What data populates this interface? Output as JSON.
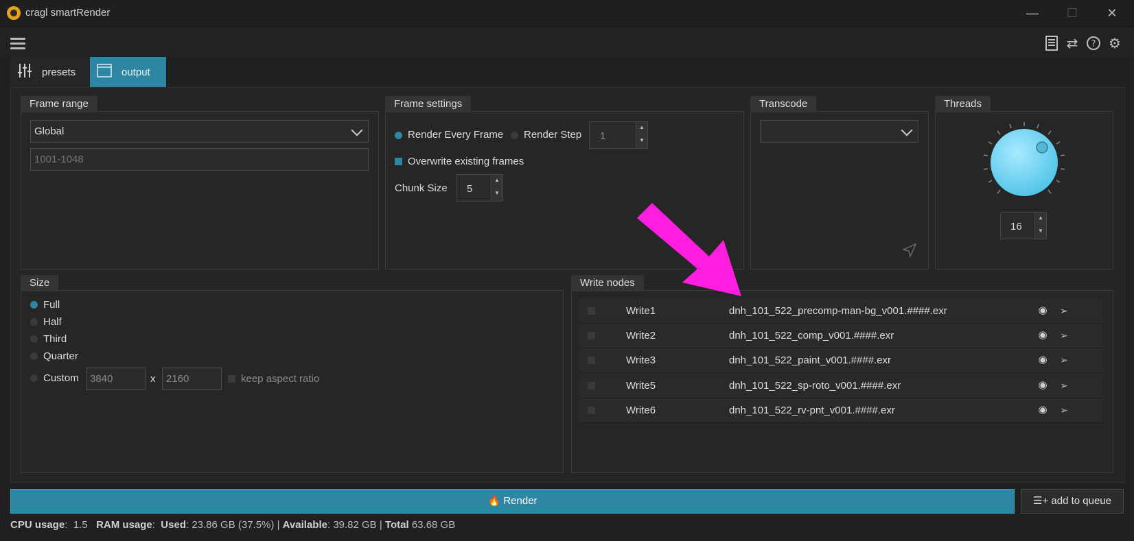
{
  "window": {
    "title": "cragl smartRender",
    "minimize_glyph": "—",
    "maximize_glyph": "☐",
    "close_glyph": "✕"
  },
  "toolbar": {
    "icons": [
      "hamburger-menu-icon",
      "document-icon",
      "swap-icon",
      "help-icon",
      "gear-icon"
    ]
  },
  "tabs": [
    {
      "label": "presets",
      "icon": "sliders-icon",
      "active": false
    },
    {
      "label": "output",
      "icon": "window-icon",
      "active": true
    }
  ],
  "frame_range": {
    "title": "Frame range",
    "mode_value": "Global",
    "range_placeholder": "1001-1048"
  },
  "frame_settings": {
    "title": "Frame settings",
    "render_every_frame": "Render Every Frame",
    "render_step": "Render Step",
    "step_value": "1",
    "overwrite_label": "Overwrite existing frames",
    "chunk_label": "Chunk Size",
    "chunk_value": "5"
  },
  "transcode": {
    "title": "Transcode",
    "value": ""
  },
  "threads": {
    "title": "Threads",
    "value": "16",
    "knob_fraction": 0.55
  },
  "size": {
    "title": "Size",
    "options": [
      "Full",
      "Half",
      "Third",
      "Quarter",
      "Custom"
    ],
    "selected": "Full",
    "width_value": "3840",
    "x_label": "x",
    "height_value": "2160",
    "keep_aspect_label": "keep aspect ratio"
  },
  "write_nodes": {
    "title": "Write nodes",
    "rows": [
      {
        "name": "Write1",
        "file": "dnh_101_522_precomp-man-bg_v001.####.exr"
      },
      {
        "name": "Write2",
        "file": "dnh_101_522_comp_v001.####.exr"
      },
      {
        "name": "Write3",
        "file": "dnh_101_522_paint_v001.####.exr"
      },
      {
        "name": "Write5",
        "file": "dnh_101_522_sp-roto_v001.####.exr"
      },
      {
        "name": "Write6",
        "file": "dnh_101_522_rv-pnt_v001.####.exr"
      }
    ]
  },
  "actions": {
    "render_label": "Render",
    "queue_label": "add to queue"
  },
  "status": {
    "cpu_label": "CPU usage",
    "cpu_value": "1.5",
    "ram_label": "RAM usage",
    "used_label": "Used",
    "used_value": "23.86 GB (37.5%)",
    "available_label": "Available",
    "available_value": "39.82 GB",
    "total_label": "Total",
    "total_value": "63.68 GB",
    "separator": "|"
  },
  "colors": {
    "accent": "#2d86a3",
    "annotation_arrow": "#ff1ee0",
    "knob": "#7fd9f5"
  }
}
